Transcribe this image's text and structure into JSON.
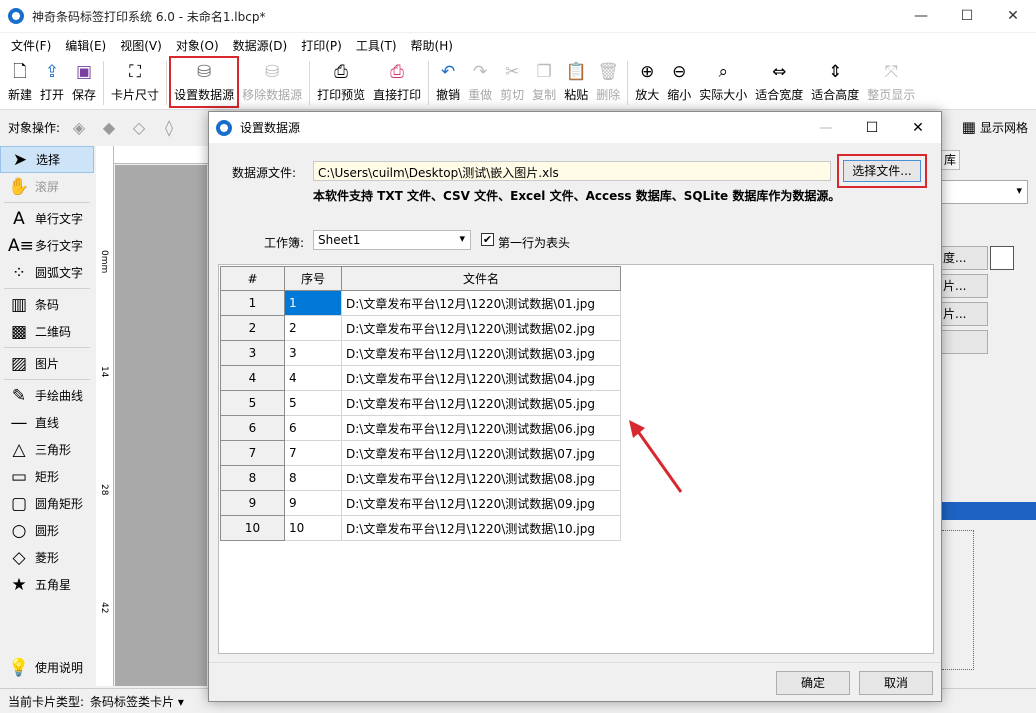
{
  "window": {
    "title": "神奇条码标签打印系统 6.0 - 未命名1.lbcp*",
    "minimize": "—",
    "maximize": "☐",
    "close": "✕"
  },
  "menu": [
    "文件(F)",
    "编辑(E)",
    "视图(V)",
    "对象(O)",
    "数据源(D)",
    "打印(P)",
    "工具(T)",
    "帮助(H)"
  ],
  "toolbar": {
    "new": "新建",
    "open": "打开",
    "save": "保存",
    "card_size": "卡片尺寸",
    "set_datasource": "设置数据源",
    "remove_datasource": "移除数据源",
    "print_preview": "打印预览",
    "direct_print": "直接打印",
    "undo": "撤销",
    "redo": "重做",
    "cut": "剪切",
    "copy": "复制",
    "paste": "粘贴",
    "delete": "删除",
    "zoom_in": "放大",
    "zoom_out": "缩小",
    "actual_size": "实际大小",
    "fit_width": "适合宽度",
    "fit_height": "适合高度",
    "full_page": "整页显示"
  },
  "object_ops": {
    "label": "对象操作:",
    "show_grid": "显示网格"
  },
  "left_tools": {
    "select": "选择",
    "scroll": "滚屏",
    "single_text": "单行文字",
    "multi_text": "多行文字",
    "arc_text": "圆弧文字",
    "barcode": "条码",
    "qrcode": "二维码",
    "image": "图片",
    "freehand": "手绘曲线",
    "line": "直线",
    "triangle": "三角形",
    "rect": "矩形",
    "round_rect": "圆角矩形",
    "circle": "圆形",
    "diamond": "菱形",
    "star": "五角星",
    "help": "使用说明"
  },
  "ruler": [
    "0mm",
    "14",
    "28",
    "42"
  ],
  "right_panel": {
    "tab": "库",
    "btn1": "度...",
    "btn2": "片...",
    "btn3": "片..."
  },
  "status": {
    "card_type_label": "当前卡片类型:",
    "card_type_value": "条码标签类卡片 ▾"
  },
  "dialog": {
    "title": "设置数据源",
    "datasource_label": "数据源文件:",
    "datasource_path": "C:\\Users\\cuilm\\Desktop\\测试\\嵌入图片.xls",
    "choose_file": "选择文件...",
    "support_note": "本软件支持 TXT 文件、CSV 文件、Excel 文件、Access 数据库、SQLite 数据库作为数据源。",
    "workbook_label": "工作簿:",
    "workbook_value": "Sheet1",
    "first_row_header_label": "第一行为表头",
    "first_row_header_checked": "✔",
    "columns": [
      "#",
      "序号",
      "文件名"
    ],
    "rows": [
      {
        "num": "1",
        "seq": "1",
        "file": "D:\\文章发布平台\\12月\\1220\\测试数据\\01.jpg"
      },
      {
        "num": "2",
        "seq": "2",
        "file": "D:\\文章发布平台\\12月\\1220\\测试数据\\02.jpg"
      },
      {
        "num": "3",
        "seq": "3",
        "file": "D:\\文章发布平台\\12月\\1220\\测试数据\\03.jpg"
      },
      {
        "num": "4",
        "seq": "4",
        "file": "D:\\文章发布平台\\12月\\1220\\测试数据\\04.jpg"
      },
      {
        "num": "5",
        "seq": "5",
        "file": "D:\\文章发布平台\\12月\\1220\\测试数据\\05.jpg"
      },
      {
        "num": "6",
        "seq": "6",
        "file": "D:\\文章发布平台\\12月\\1220\\测试数据\\06.jpg"
      },
      {
        "num": "7",
        "seq": "7",
        "file": "D:\\文章发布平台\\12月\\1220\\测试数据\\07.jpg"
      },
      {
        "num": "8",
        "seq": "8",
        "file": "D:\\文章发布平台\\12月\\1220\\测试数据\\08.jpg"
      },
      {
        "num": "9",
        "seq": "9",
        "file": "D:\\文章发布平台\\12月\\1220\\测试数据\\09.jpg"
      },
      {
        "num": "10",
        "seq": "10",
        "file": "D:\\文章发布平台\\12月\\1220\\测试数据\\10.jpg"
      }
    ],
    "ok": "确定",
    "cancel": "取消"
  },
  "colors": {
    "highlight_red": "#d9272e",
    "selection_blue": "#0078d7",
    "input_bg": "#fffbe6"
  }
}
